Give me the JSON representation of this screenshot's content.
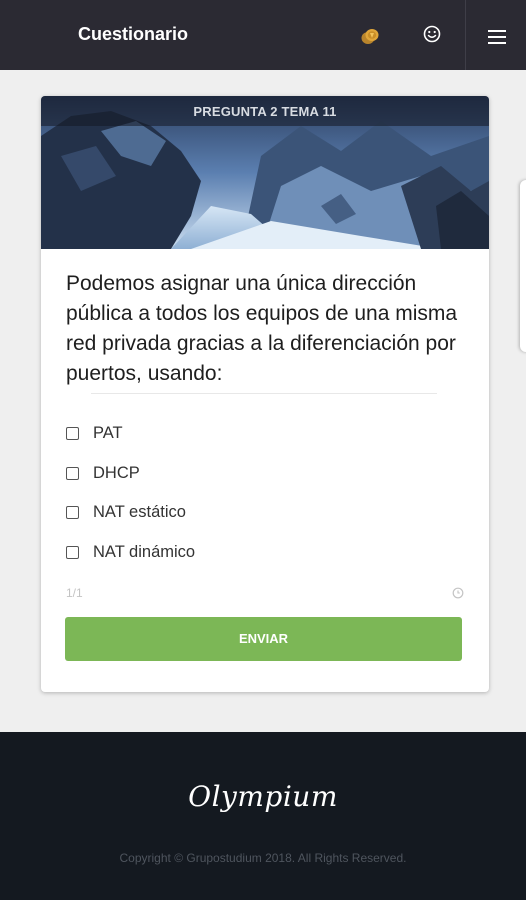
{
  "header": {
    "title": "Cuestionario",
    "icons": [
      "coins-icon",
      "smiley-icon",
      "hamburger-menu-icon"
    ],
    "background_color": "#2b2a33"
  },
  "card": {
    "banner_label": "PREGUNTA 2 TEMA 11",
    "question": "Podemos asignar una única dirección pública a todos los equipos de una misma red privada gracias a la diferenciación por puertos, usando:",
    "options": [
      {
        "label": "PAT",
        "checked": false
      },
      {
        "label": "DHCP",
        "checked": false
      },
      {
        "label": "NAT estático",
        "checked": false
      },
      {
        "label": "NAT dinámico",
        "checked": false
      }
    ],
    "counter": "1/1",
    "submit_label": "ENVIAR",
    "submit_color": "#7cb756"
  },
  "footer": {
    "logo": "Olympium",
    "copyright": "Copyright © Grupostudium 2018. All Rights Reserved.",
    "background_color": "#141920"
  }
}
